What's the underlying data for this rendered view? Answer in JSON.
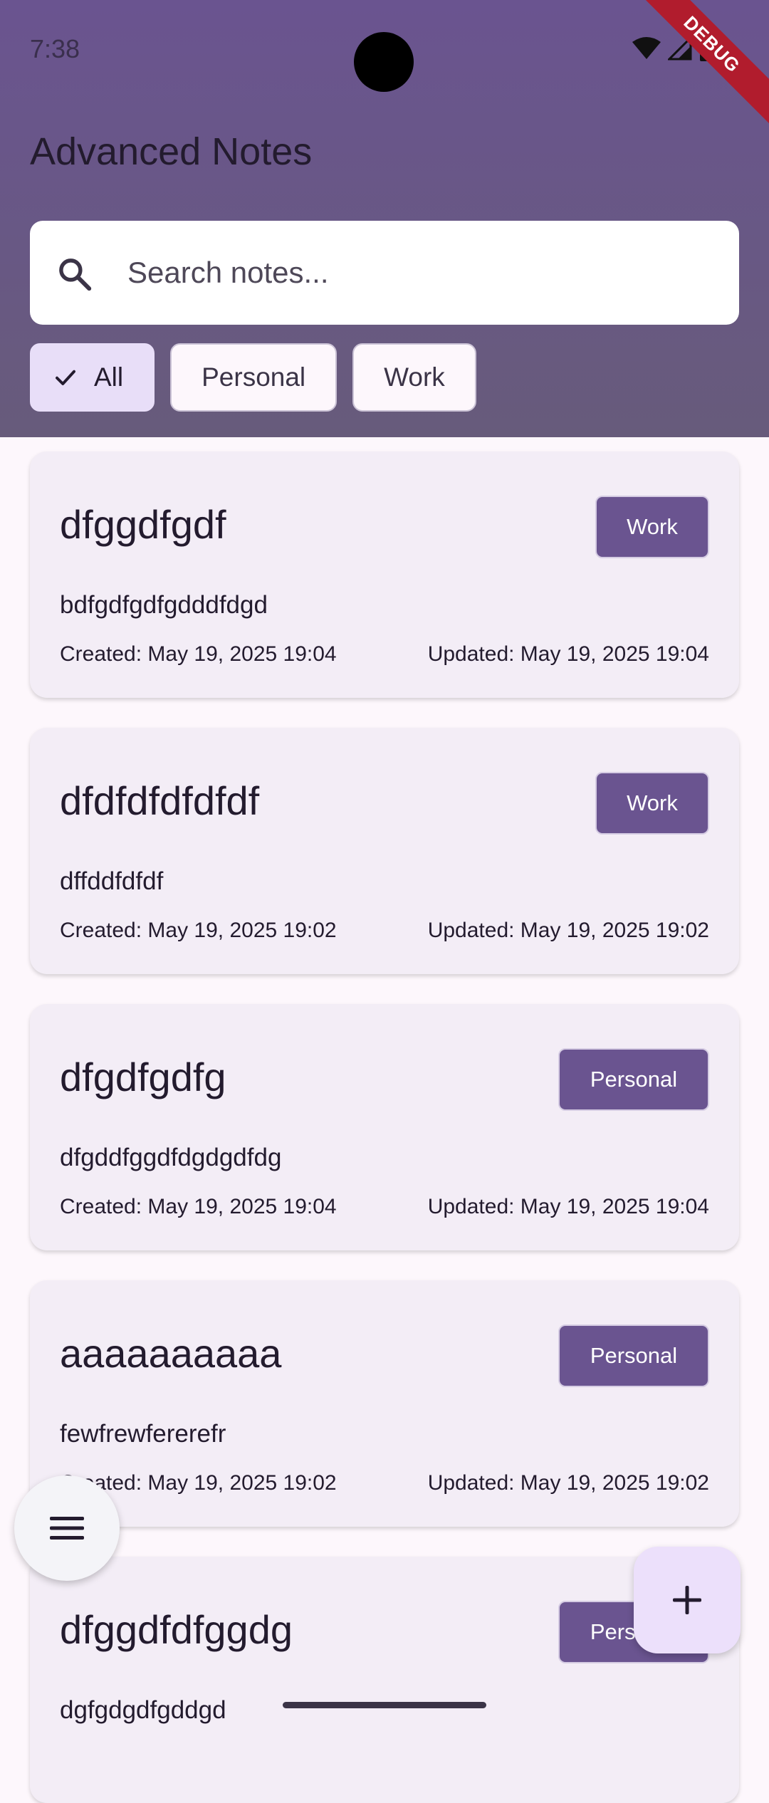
{
  "status_bar": {
    "time": "7:38",
    "debug_label": "DEBUG"
  },
  "app": {
    "title": "Advanced Notes"
  },
  "search": {
    "placeholder": "Search notes..."
  },
  "filters": [
    {
      "label": "All",
      "selected": true
    },
    {
      "label": "Personal",
      "selected": false
    },
    {
      "label": "Work",
      "selected": false
    }
  ],
  "notes": [
    {
      "title": "dfggdfgdf",
      "category": "Work",
      "content": "bdfgdfgdfgdddfdgd",
      "created": "Created: May 19, 2025 19:04",
      "updated": "Updated: May 19, 2025 19:04"
    },
    {
      "title": "dfdfdfdfdfdf",
      "category": "Work",
      "content": "dffddfdfdf",
      "created": "Created: May 19, 2025 19:02",
      "updated": "Updated: May 19, 2025 19:02"
    },
    {
      "title": "dfgdfgdfg",
      "category": "Personal",
      "content": "dfgddfggdfdgdgdfdg",
      "created": "Created: May 19, 2025 19:04",
      "updated": "Updated: May 19, 2025 19:04"
    },
    {
      "title": "aaaaaaaaaa",
      "category": "Personal",
      "content": "fewfrewfererefr",
      "created": "Created: May 19, 2025 19:02",
      "updated": "Updated: May 19, 2025 19:02"
    },
    {
      "title": "dfggdfdfggdg",
      "category": "Personal",
      "content": "dgfgdgdfgddgd",
      "created": "",
      "updated": ""
    }
  ],
  "icons": {
    "search": "search-icon",
    "check": "check-icon",
    "menu": "menu-icon",
    "add": "add-icon"
  },
  "colors": {
    "primary": "#6a5490",
    "header_bottom": "#675b7b",
    "chip_selected": "#e8def8",
    "card_bg": "#f3edf6",
    "debug": "#b11c2d"
  }
}
